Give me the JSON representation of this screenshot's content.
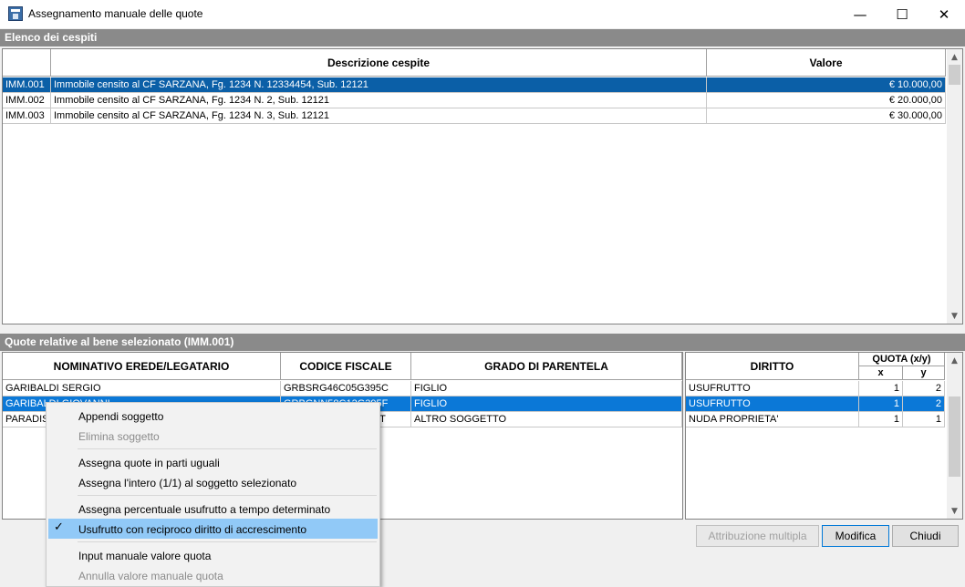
{
  "window": {
    "title": "Assegnamento manuale delle quote",
    "controls": {
      "minimize": "—",
      "maximize": "☐",
      "close": "✕"
    }
  },
  "section1": {
    "title": "Elenco dei cespiti"
  },
  "assets": {
    "columns": [
      "",
      "Descrizione cespite",
      "Valore"
    ],
    "rows": [
      {
        "code": "IMM.001",
        "description": "Immobile censito al CF SARZANA, Fg. 1234 N. 12334454, Sub. 12121",
        "value": "€ 10.000,00"
      },
      {
        "code": "IMM.002",
        "description": "Immobile censito al CF SARZANA, Fg. 1234 N. 2, Sub. 12121",
        "value": "€ 20.000,00"
      },
      {
        "code": "IMM.003",
        "description": "Immobile censito al CF SARZANA, Fg. 1234 N. 3, Sub. 12121",
        "value": "€ 30.000,00"
      }
    ]
  },
  "section2": {
    "title": "Quote relative al bene selezionato (IMM.001)"
  },
  "heirs": {
    "columns": [
      "NOMINATIVO EREDE/LEGATARIO",
      "CODICE FISCALE",
      "GRADO DI PARENTELA"
    ],
    "rows": [
      {
        "name": "GARIBALDI SERGIO",
        "cf": "GRBSRG46C05G395C",
        "grade": "FIGLIO"
      },
      {
        "name": "GARIBALDI GIOVANNI",
        "cf": "GRBGNN58C12G395F",
        "grade": "FIGLIO"
      },
      {
        "name": "PARADISI ANNA",
        "cf": "PRDNNA60A41G395T",
        "grade": "ALTRO SOGGETTO"
      }
    ]
  },
  "rights": {
    "columns": {
      "right": "DIRITTO",
      "quota": "QUOTA (x/y)",
      "x": "x",
      "y": "y"
    },
    "rows": [
      {
        "right": "USUFRUTTO",
        "x": "1",
        "y": "2"
      },
      {
        "right": "USUFRUTTO",
        "x": "1",
        "y": "2"
      },
      {
        "right": "NUDA PROPRIETA'",
        "x": "1",
        "y": "1"
      }
    ]
  },
  "buttons": {
    "multi": "Attribuzione multipla",
    "edit": "Modifica",
    "close": "Chiudi"
  },
  "context_menu": {
    "items": [
      {
        "label": "Appendi soggetto",
        "enabled": true
      },
      {
        "label": "Elimina soggetto",
        "enabled": false
      },
      {
        "label": "Assegna quote in parti uguali",
        "enabled": true
      },
      {
        "label": "Assegna l'intero (1/1) al soggetto selezionato",
        "enabled": true
      },
      {
        "label": "Assegna percentuale usufrutto a tempo determinato",
        "enabled": true
      },
      {
        "label": "Usufrutto con reciproco diritto di accrescimento",
        "enabled": true,
        "checked": true
      },
      {
        "label": "Input manuale valore quota",
        "enabled": true
      },
      {
        "label": "Annulla valore manuale quota",
        "enabled": false
      }
    ],
    "check_glyph": "✓"
  },
  "icons": {
    "scroll_up": "▲",
    "scroll_down": "▼"
  }
}
